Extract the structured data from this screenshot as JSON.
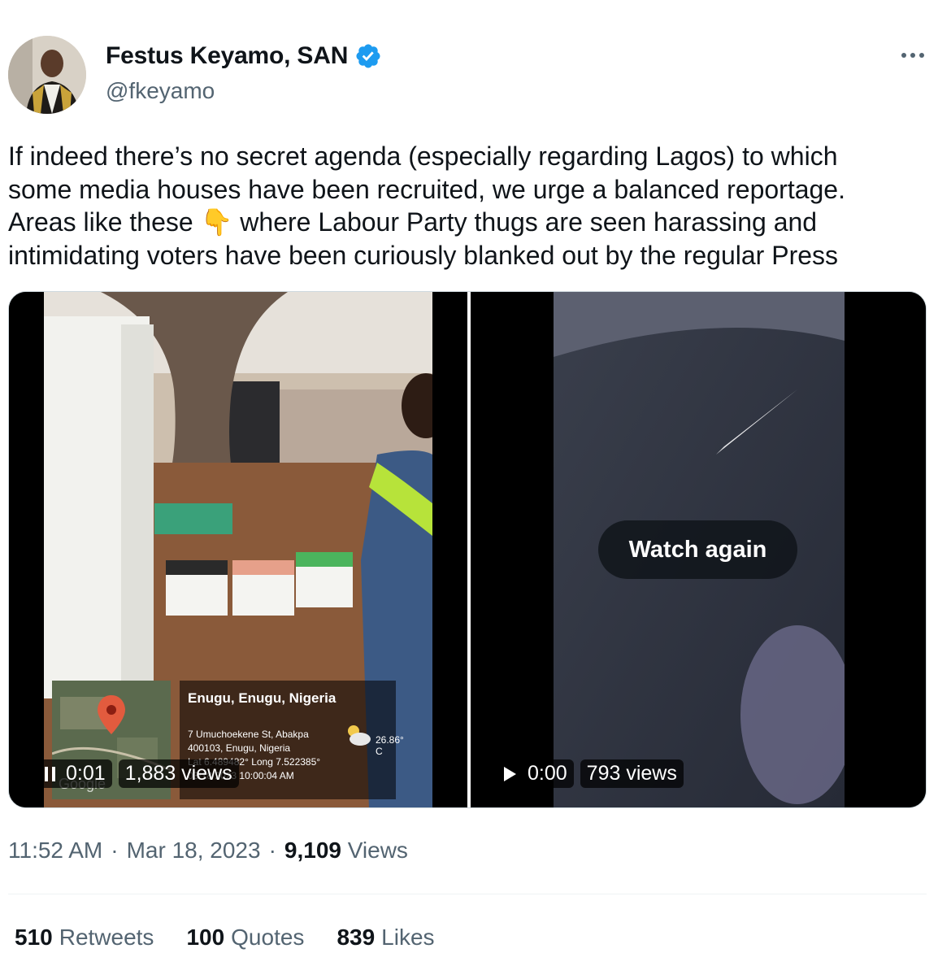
{
  "author": {
    "display_name": "Festus Keyamo, SAN",
    "handle": "@fkeyamo",
    "verified": true,
    "verified_color": "#1d9bf0"
  },
  "tweet": {
    "text": "If indeed there’s no secret agenda (especially regarding Lagos) to which\nsome media houses have been recruited, we urge a balanced reportage.\nAreas like these 👇 where Labour Party thugs are seen harassing and\nintimidating voters have been curiously blanked out by the regular Press"
  },
  "media": {
    "video1": {
      "state": "playing",
      "time": "0:01",
      "views": "1,883 views",
      "geo_title": "Enugu, Enugu, Nigeria",
      "geo_address": "7 Umuchoekene St, Abakpa\n400103, Enugu, Nigeria\nLat 6.489482° Long 7.522385°\n03/18/2023 10:00:04 AM",
      "temperature": "26.86° C",
      "map_label": "Google"
    },
    "video2": {
      "state": "ended",
      "time": "0:00",
      "views": "793 views",
      "watch_again_label": "Watch again"
    }
  },
  "meta": {
    "time": "11:52 AM",
    "date": "Mar 18, 2023",
    "views_count": "9,109",
    "views_label": "Views"
  },
  "engagement": {
    "retweets_count": "510",
    "retweets_label": "Retweets",
    "quotes_count": "100",
    "quotes_label": "Quotes",
    "likes_count": "839",
    "likes_label": "Likes"
  }
}
